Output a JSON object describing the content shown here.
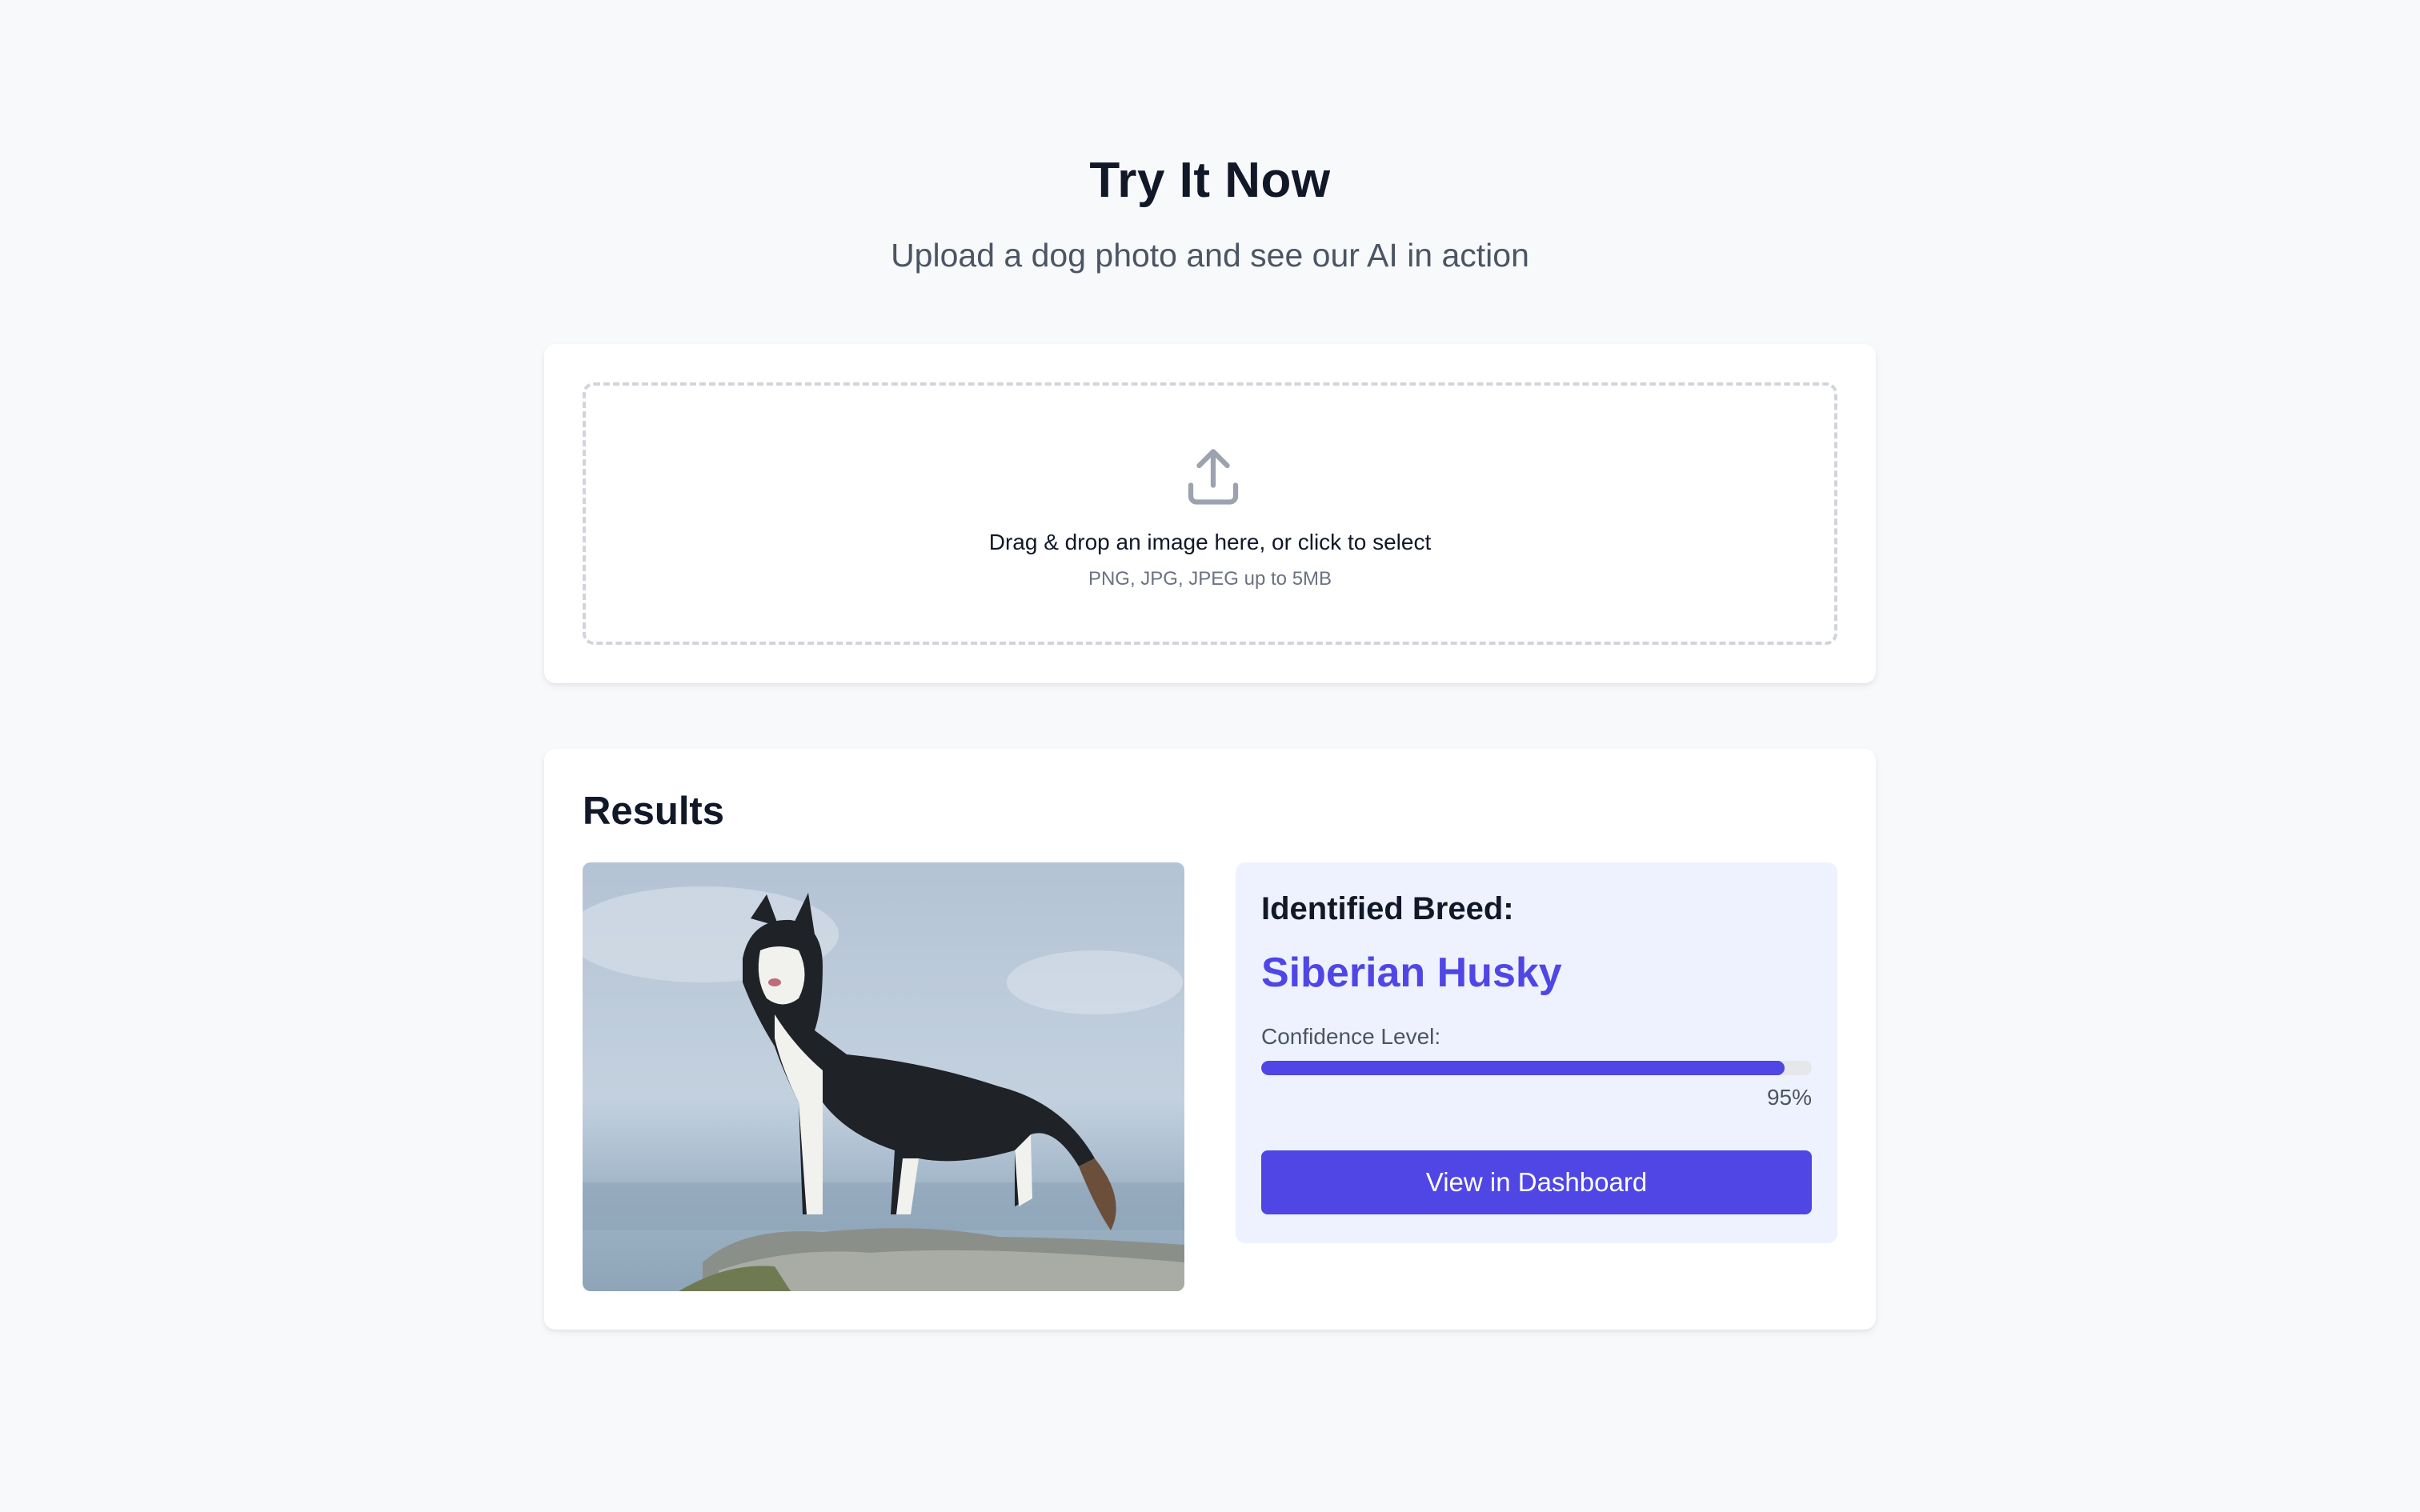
{
  "hero": {
    "title": "Try It Now",
    "subtitle": "Upload a dog photo and see our AI in action"
  },
  "upload": {
    "icon": "upload-icon",
    "prompt": "Drag & drop an image here, or click to select",
    "hint": "PNG, JPG, JPEG up to 5MB"
  },
  "results": {
    "title": "Results",
    "breed_label": "Identified Breed:",
    "breed_name": "Siberian Husky",
    "confidence_label": "Confidence Level:",
    "confidence_value": "95%",
    "confidence_fraction": 0.95,
    "button_label": "View in Dashboard"
  },
  "colors": {
    "accent": "#4f46e5",
    "panel_bg": "#eef2fe",
    "page_bg": "#f8f9fb"
  }
}
